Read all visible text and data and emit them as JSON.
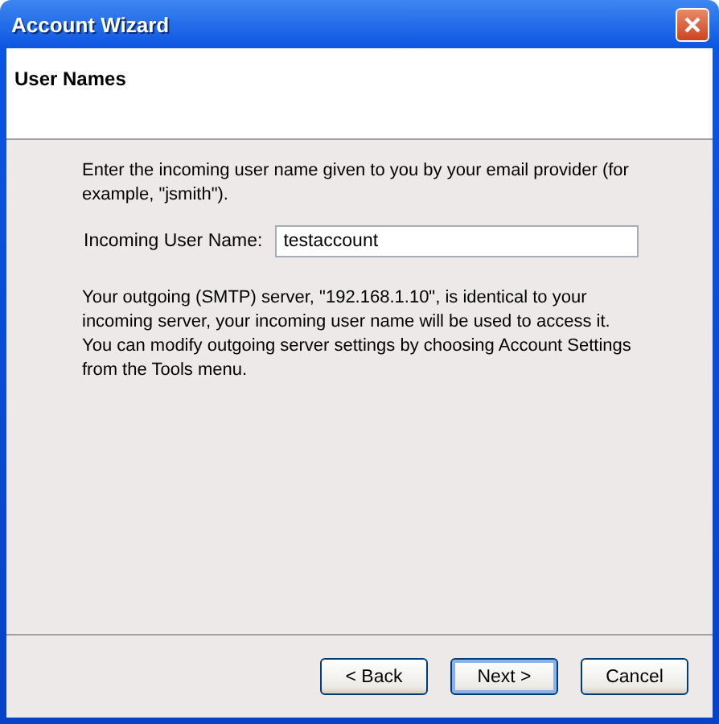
{
  "window": {
    "title": "Account Wizard"
  },
  "page": {
    "heading": "User Names"
  },
  "intro": "Enter the incoming user name given to you by your email provider (for example, \"jsmith\").",
  "field": {
    "label": "Incoming User Name:",
    "value": "testaccount"
  },
  "note": "Your outgoing (SMTP) server, \"192.168.1.10\", is identical to your incoming server, your incoming user name will be used to access it. You can modify outgoing server settings by choosing Account Settings from the Tools menu.",
  "buttons": [
    {
      "label": "< Back",
      "default": false
    },
    {
      "label": "Next >",
      "default": true
    },
    {
      "label": "Cancel",
      "default": false
    }
  ]
}
